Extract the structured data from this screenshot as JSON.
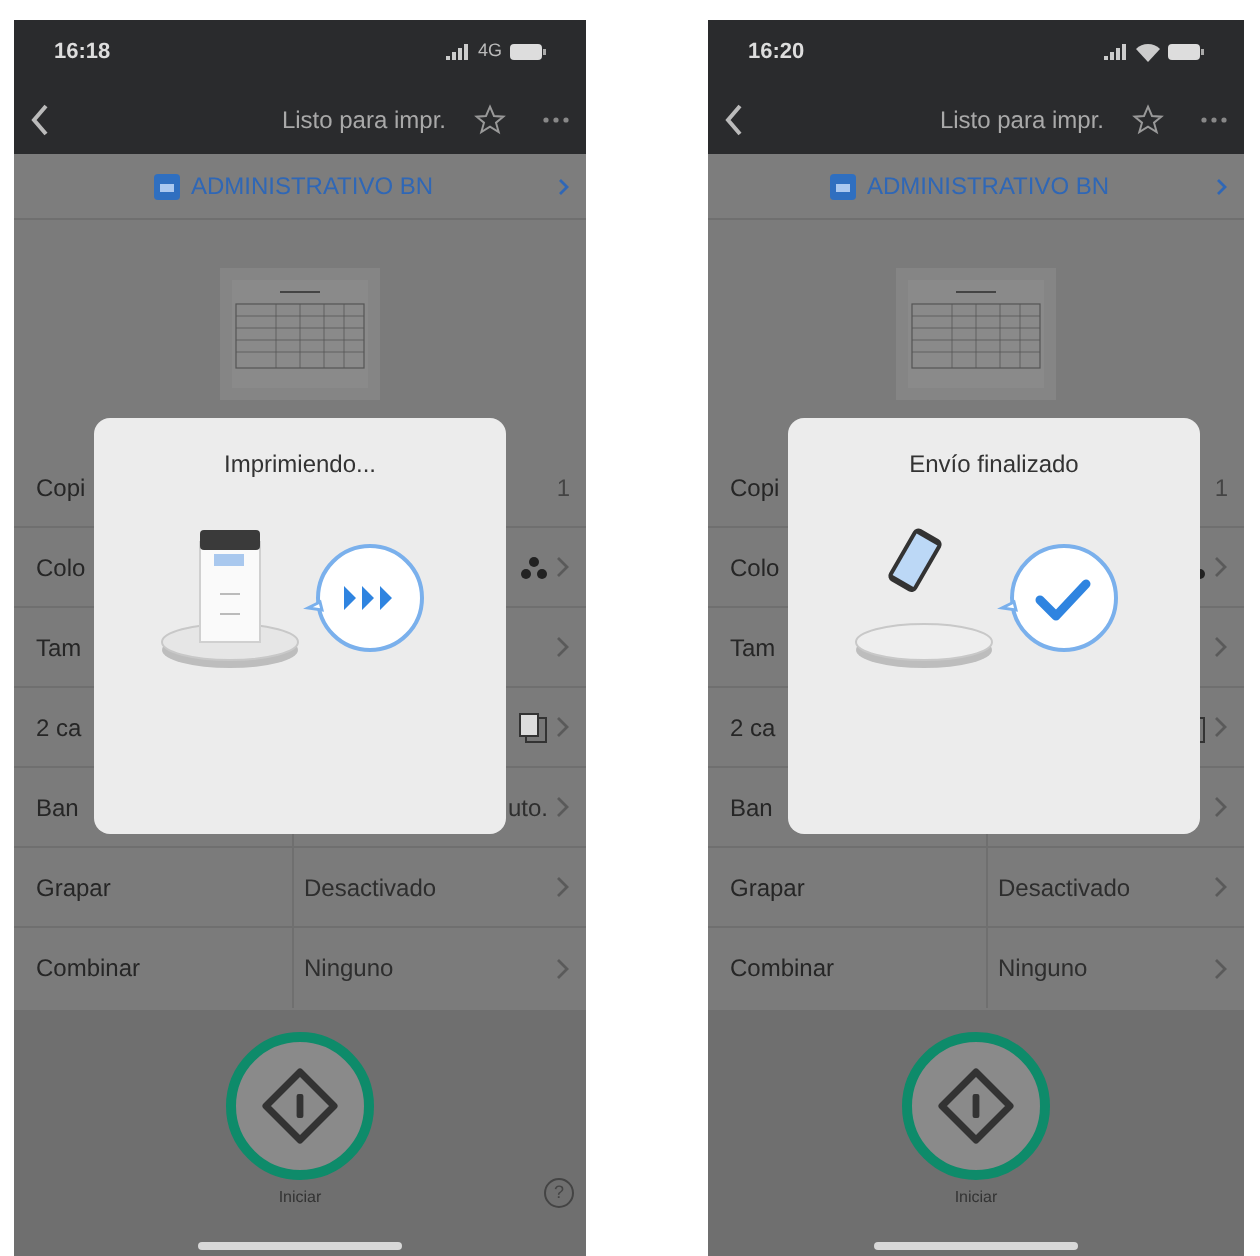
{
  "phones": [
    {
      "status": {
        "time": "16:18",
        "network": {
          "kind": "text",
          "label": "4G"
        }
      },
      "nav": {
        "title": "Listo para impr."
      },
      "printer": {
        "name": "ADMINISTRATIVO BN"
      },
      "settings": [
        {
          "label": "Copi",
          "value": "1",
          "kind": "count"
        },
        {
          "label": "Colo",
          "kind": "color"
        },
        {
          "label": "Tam",
          "kind": "plain"
        },
        {
          "label": "2 ca",
          "kind": "duplex"
        },
        {
          "label": "Ban",
          "value": "uto.",
          "kind": "tray"
        },
        {
          "label": "Grapar",
          "value": "Desactivado",
          "kind": "plain"
        },
        {
          "label": "Combinar",
          "value": "Ninguno",
          "kind": "plain"
        }
      ],
      "dialog": {
        "title": "Imprimiendo...",
        "kind": "printing"
      },
      "start": {
        "label": "Iniciar"
      },
      "help": "?"
    },
    {
      "status": {
        "time": "16:20",
        "network": {
          "kind": "wifi"
        }
      },
      "nav": {
        "title": "Listo para impr."
      },
      "printer": {
        "name": "ADMINISTRATIVO BN"
      },
      "settings": [
        {
          "label": "Copi",
          "value": "1",
          "kind": "count"
        },
        {
          "label": "Colo",
          "kind": "color"
        },
        {
          "label": "Tam",
          "kind": "plain"
        },
        {
          "label": "2 ca",
          "kind": "duplex"
        },
        {
          "label": "Ban",
          "kind": "tray"
        },
        {
          "label": "Grapar",
          "value": "Desactivado",
          "kind": "plain"
        },
        {
          "label": "Combinar",
          "value": "Ninguno",
          "kind": "plain"
        }
      ],
      "dialog": {
        "title": "Envío finalizado",
        "kind": "done"
      },
      "start": {
        "label": "Iniciar"
      }
    }
  ]
}
